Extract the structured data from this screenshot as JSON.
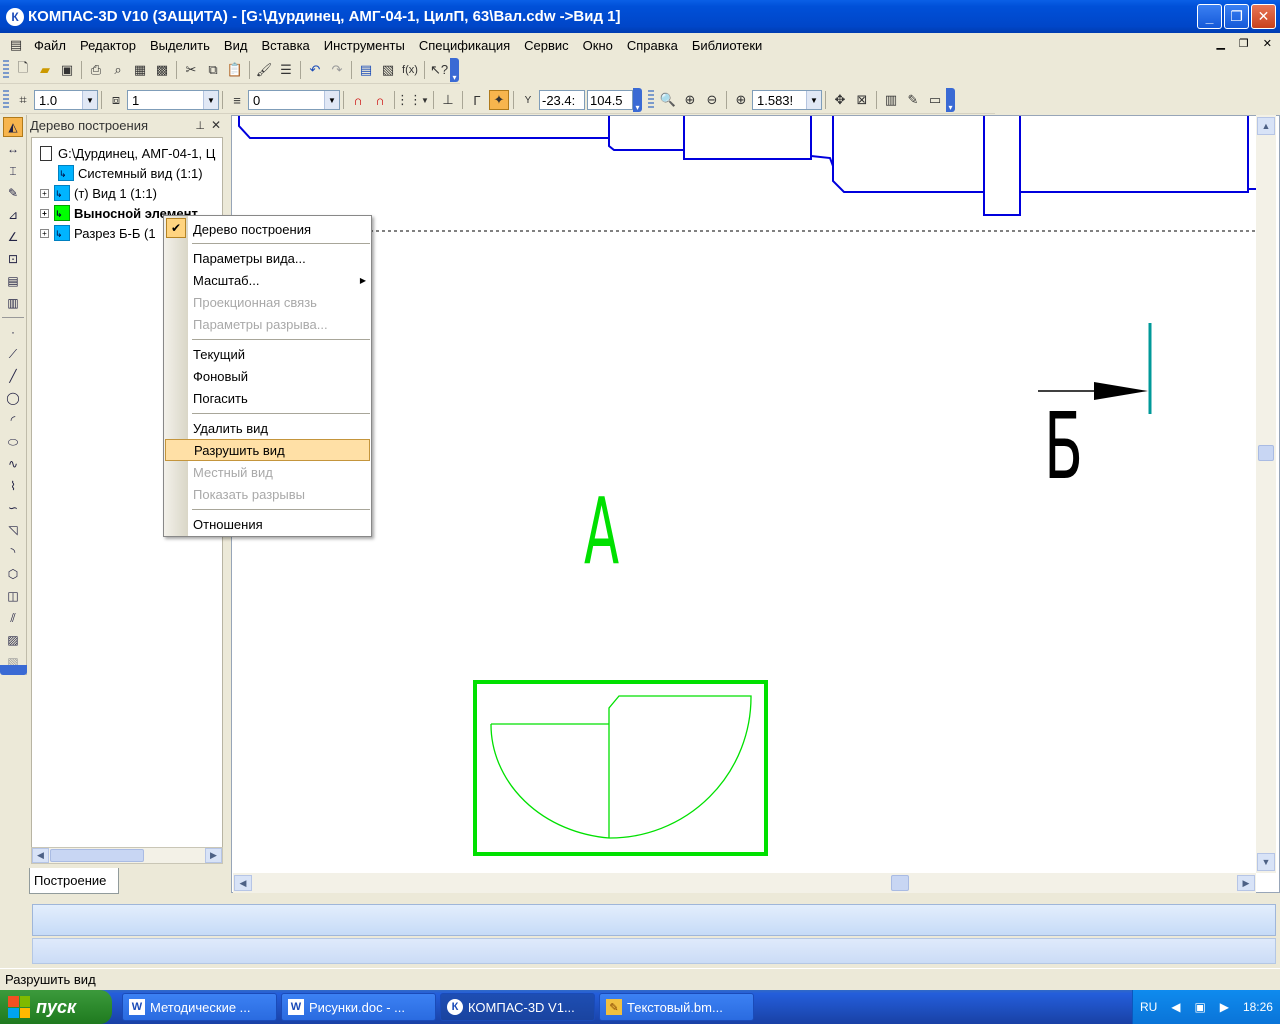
{
  "window": {
    "title": "КОМПАС-3D V10 (ЗАЩИТА) - [G:\\Дурдинец, АМГ-04-1, ЦилП, 63\\Вал.cdw ->Вид 1]",
    "app_icon": "К"
  },
  "menubar": {
    "items": [
      "Файл",
      "Редактор",
      "Выделить",
      "Вид",
      "Вставка",
      "Инструменты",
      "Спецификация",
      "Сервис",
      "Окно",
      "Справка",
      "Библиотеки"
    ]
  },
  "toolbar2": {
    "scale_value": "1.0",
    "layer_value": "1",
    "style_value": "0",
    "coord_x": "-23.4:",
    "coord_y": "104.5",
    "zoom_value": "1.583!"
  },
  "panel": {
    "title": "Дерево построения",
    "tab_label": "Построение",
    "tree": [
      {
        "label": "G:\\Дурдинец, АМГ-04-1, Ц"
      },
      {
        "label": "Системный вид (1:1)"
      },
      {
        "label": "(т) Вид 1 (1:1)"
      },
      {
        "label": "Выносной элемент"
      },
      {
        "label": "Разрез Б-Б (1"
      }
    ]
  },
  "context_menu": {
    "items": [
      {
        "label": "Дерево построения",
        "checked": true
      },
      {
        "label": "Параметры вида..."
      },
      {
        "label": "Масштаб..."
      },
      {
        "label": "Проекционная связь"
      },
      {
        "label": "Параметры разрыва..."
      },
      {
        "label": "Текущий"
      },
      {
        "label": "Фоновый"
      },
      {
        "label": "Погасить"
      },
      {
        "label": "Удалить вид"
      },
      {
        "label": "Разрушить вид"
      },
      {
        "label": "Местный вид"
      },
      {
        "label": "Показать разрывы"
      },
      {
        "label": "Отношения"
      }
    ]
  },
  "drawing": {
    "label_a": "А",
    "label_b": "Б",
    "colors": {
      "geometry": "#0000dd",
      "view_a": "#00e000",
      "section_line": "#009999"
    }
  },
  "statusbar": {
    "text": "Разрушить вид"
  },
  "taskbar": {
    "start_label": "пуск",
    "tasks": [
      {
        "label": "Методические ..."
      },
      {
        "label": "Рисунки.doc - ..."
      },
      {
        "label": "КОМПАС-3D V1..."
      },
      {
        "label": "Текстовый.bm..."
      }
    ],
    "tray_lang": "RU",
    "clock": "18:26"
  }
}
